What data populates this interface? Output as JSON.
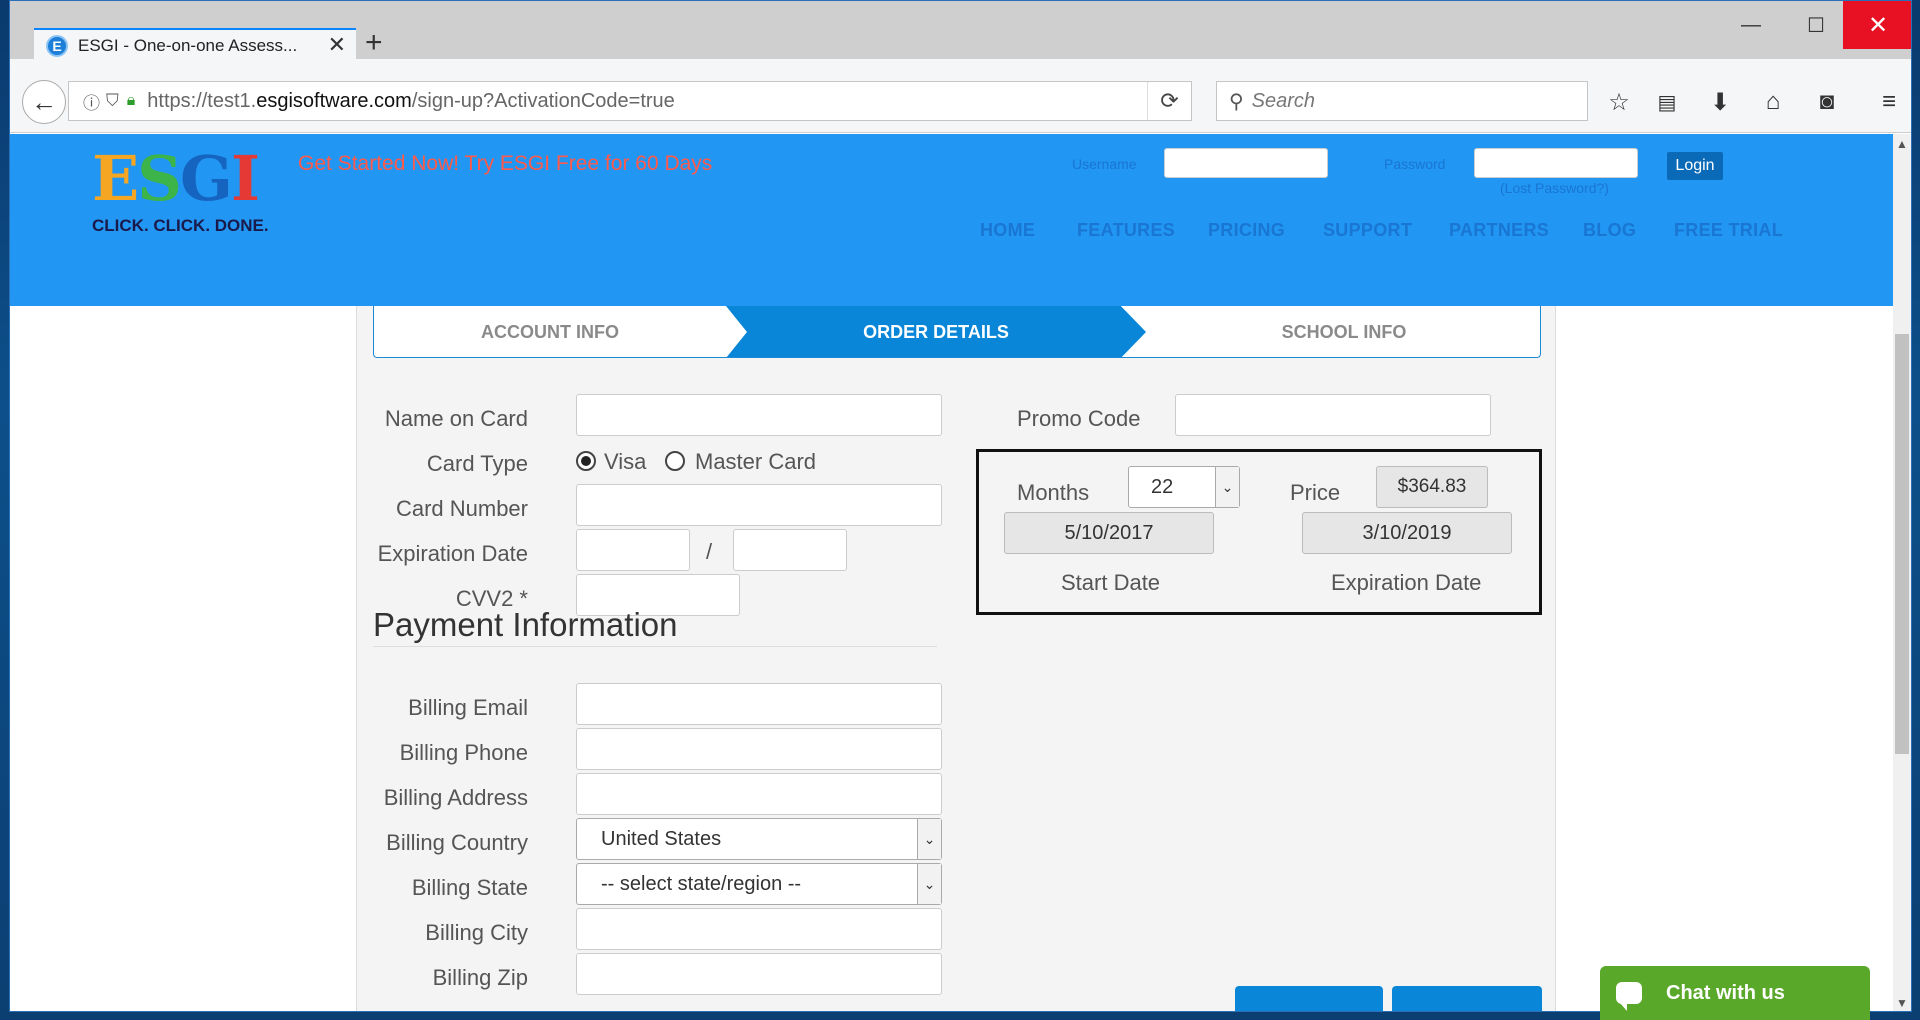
{
  "browser": {
    "tab_title": "ESGI - One-on-one Assess...",
    "favicon": "E",
    "url_prefix": "https://test1.",
    "url_domain": "esgisoftware.com",
    "url_path": "/sign-up?ActivationCode=true",
    "search_placeholder": "Search"
  },
  "header": {
    "logo_letters": [
      "E",
      "S",
      "G",
      "I"
    ],
    "logo_tagline": "CLICK. CLICK. DONE.",
    "promo_text": "Get Started Now! Try ESGI Free for 60 Days",
    "username_label": "Username",
    "password_label": "Password",
    "login_button": "Login",
    "lost_password": "(Lost Password?)",
    "nav": [
      "HOME",
      "FEATURES",
      "PRICING",
      "SUPPORT",
      "PARTNERS",
      "BLOG",
      "FREE TRIAL"
    ]
  },
  "steps": {
    "account": "ACCOUNT INFO",
    "order": "ORDER DETAILS",
    "school": "SCHOOL INFO"
  },
  "form": {
    "name_on_card": "Name on Card",
    "card_type": "Card Type",
    "visa": "Visa",
    "mastercard": "Master Card",
    "card_number": "Card Number",
    "expiration_date": "Expiration Date",
    "slash": "/",
    "cvv2": "CVV2 *",
    "payment_heading": "Payment Information",
    "billing_email": "Billing Email",
    "billing_phone": "Billing Phone",
    "billing_address": "Billing Address",
    "billing_country": "Billing Country",
    "billing_country_value": "United States",
    "billing_state": "Billing State",
    "billing_state_value": "-- select state/region --",
    "billing_city": "Billing City",
    "billing_zip": "Billing Zip"
  },
  "order": {
    "promo_code": "Promo Code",
    "months_label": "Months",
    "months_value": "22",
    "price_label": "Price",
    "price_value": "$364.83",
    "start_date_value": "5/10/2017",
    "expiration_value": "3/10/2019",
    "start_date_label": "Start Date",
    "expiration_label": "Expiration Date"
  },
  "chat": {
    "label": "Chat with us"
  },
  "colors": {
    "header_bg": "#2196f3",
    "step_active": "#0a86d8",
    "promo": "#ff5a4a",
    "chat": "#5aa82a",
    "close": "#e81123"
  }
}
